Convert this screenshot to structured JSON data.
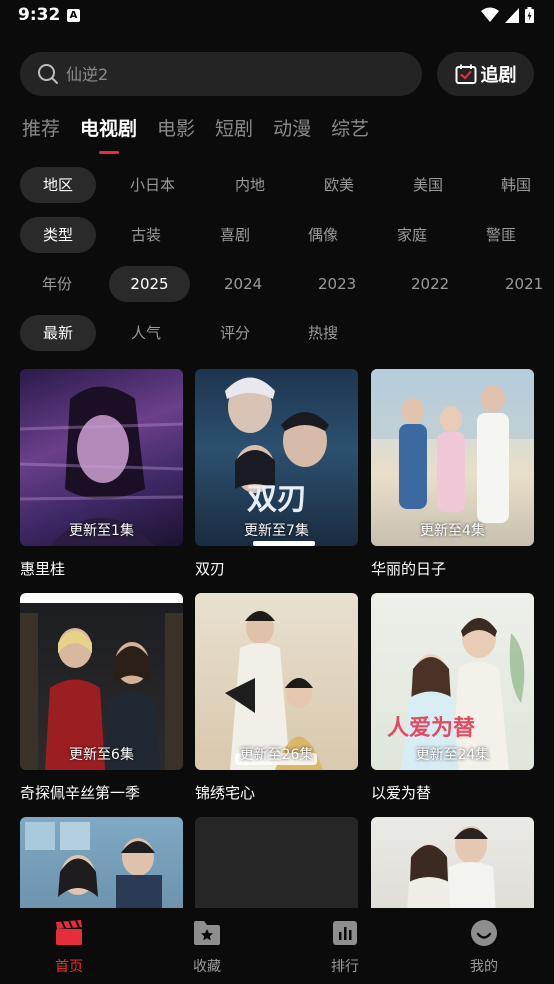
{
  "status_bar": {
    "time": "9:32",
    "notif_glyph": "A"
  },
  "search": {
    "placeholder": "仙逆2",
    "follow_label": "追剧"
  },
  "top_tabs": [
    {
      "label": "推荐",
      "active": false
    },
    {
      "label": "电视剧",
      "active": true
    },
    {
      "label": "电影",
      "active": false
    },
    {
      "label": "短剧",
      "active": false
    },
    {
      "label": "动漫",
      "active": false
    },
    {
      "label": "综艺",
      "active": false
    }
  ],
  "filters": {
    "region": {
      "items": [
        "地区",
        "小日本",
        "内地",
        "欧美",
        "美国",
        "韩国"
      ],
      "selected": 0
    },
    "genre": {
      "items": [
        "类型",
        "古装",
        "喜剧",
        "偶像",
        "家庭",
        "警匪"
      ],
      "selected": 0
    },
    "year": {
      "items": [
        "年份",
        "2025",
        "2024",
        "2023",
        "2022",
        "2021"
      ],
      "selected": 1
    },
    "sort": {
      "items": [
        "最新",
        "人气",
        "评分",
        "热搜"
      ],
      "selected": 0
    }
  },
  "shows": [
    {
      "title": "惠里桂",
      "badge": "更新至1集"
    },
    {
      "title": "双刃",
      "badge": "更新至7集"
    },
    {
      "title": "华丽的日子",
      "badge": "更新至4集"
    },
    {
      "title": "奇探佩辛丝第一季",
      "badge": "更新至6集"
    },
    {
      "title": "锦绣宅心",
      "badge": "更新至26集"
    },
    {
      "title": "以爱为替",
      "badge": "更新至24集"
    },
    {
      "title": "",
      "badge": ""
    },
    {
      "title": "",
      "badge": ""
    },
    {
      "title": "",
      "badge": ""
    }
  ],
  "bottom_nav": [
    {
      "label": "首页",
      "icon": "clapperboard-icon",
      "active": true
    },
    {
      "label": "收藏",
      "icon": "folder-star-icon",
      "active": false
    },
    {
      "label": "排行",
      "icon": "bar-chart-icon",
      "active": false
    },
    {
      "label": "我的",
      "icon": "smiley-icon",
      "active": false
    }
  ],
  "colors": {
    "accent": "#e62d3c",
    "background": "#0b0b0b",
    "chip_bg": "#2a2a2a",
    "search_bg": "#242424"
  }
}
